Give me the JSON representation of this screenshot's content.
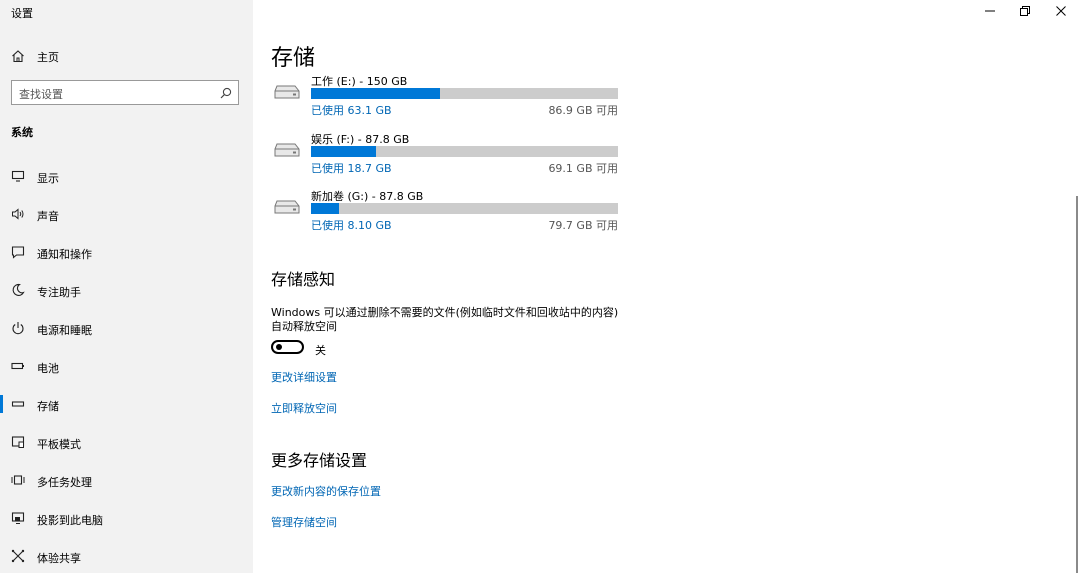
{
  "window": {
    "title": "设置",
    "controls": [
      "minimize-icon",
      "restore-icon",
      "close-icon"
    ]
  },
  "sidebar": {
    "home_label": "主页",
    "search_placeholder": "查找设置",
    "section_title": "系统",
    "items": [
      {
        "label": "显示",
        "icon": "display-icon"
      },
      {
        "label": "声音",
        "icon": "speaker-icon"
      },
      {
        "label": "通知和操作",
        "icon": "notification-icon"
      },
      {
        "label": "专注助手",
        "icon": "moon-icon"
      },
      {
        "label": "电源和睡眠",
        "icon": "power-icon"
      },
      {
        "label": "电池",
        "icon": "battery-icon"
      },
      {
        "label": "存储",
        "icon": "storage-icon",
        "active": true
      },
      {
        "label": "平板模式",
        "icon": "tablet-icon"
      },
      {
        "label": "多任务处理",
        "icon": "multitask-icon"
      },
      {
        "label": "投影到此电脑",
        "icon": "project-icon"
      },
      {
        "label": "体验共享",
        "icon": "share-icon"
      }
    ]
  },
  "main": {
    "title": "存储",
    "drives": [
      {
        "name": "工作 (E:) - 150 GB",
        "used": "已使用 63.1 GB",
        "free": "86.9 GB 可用",
        "used_fraction": 0.421
      },
      {
        "name": "娱乐 (F:) - 87.8 GB",
        "used": "已使用 18.7 GB",
        "free": "69.1 GB 可用",
        "used_fraction": 0.213
      },
      {
        "name": "新加卷 (G:) - 87.8 GB",
        "used": "已使用 8.10 GB",
        "free": "79.7 GB 可用",
        "used_fraction": 0.092
      }
    ],
    "storage_sense": {
      "heading": "存储感知",
      "description_line1": "Windows 可以通过删除不需要的文件(例如临时文件和回收站中的内容)",
      "description_line2": "自动释放空间",
      "toggle_label": "关",
      "toggle_on": false,
      "link_change_settings": "更改详细设置",
      "link_free_now": "立即释放空间"
    },
    "more_settings": {
      "heading": "更多存储设置",
      "link_save_location": "更改新内容的保存位置",
      "link_manage_spaces": "管理存储空间"
    }
  },
  "colors": {
    "accent": "#0078d7",
    "link": "#0066b4",
    "sidebar_bg": "#f2f2f2",
    "bar_bg": "#cccccc"
  }
}
